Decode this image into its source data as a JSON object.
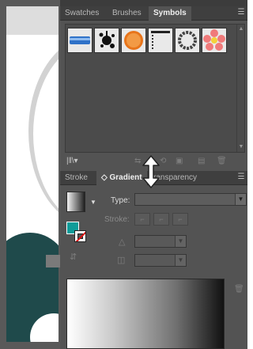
{
  "panels": {
    "top": {
      "tabs": [
        "Swatches",
        "Brushes",
        "Symbols"
      ],
      "active_tab": "Symbols",
      "menu_icon": "panel-menu-icon",
      "symbols": [
        {
          "name": "blue-banner-symbol"
        },
        {
          "name": "ink-splat-symbol"
        },
        {
          "name": "orange-button-symbol"
        },
        {
          "name": "dashed-ruler-symbol"
        },
        {
          "name": "ring-symbol"
        },
        {
          "name": "flower-symbol"
        }
      ],
      "footer_icons": [
        "library-icon",
        "break-link-icon",
        "place-symbol-icon",
        "symbol-options-icon",
        "new-symbol-icon",
        "delete-symbol-icon"
      ]
    },
    "gradient": {
      "tabs": [
        "Stroke",
        "Gradient",
        "Transparency"
      ],
      "active_tab": "Gradient",
      "gradient_tab_prefix": "◇",
      "visible_tab_text": {
        "stroke": "Stroke",
        "gradient": "Gradient",
        "transparency": "ransparency"
      },
      "type_label": "Type:",
      "type_value": "",
      "stroke_label": "Stroke:",
      "angle_value": "",
      "aspect_value": "",
      "colors": {
        "fill": "#0f9c99",
        "gradient_start": "#ffffff",
        "gradient_end": "#111111"
      }
    }
  },
  "indicator": {
    "icon": "double-headed-vertical-arrow-icon"
  }
}
